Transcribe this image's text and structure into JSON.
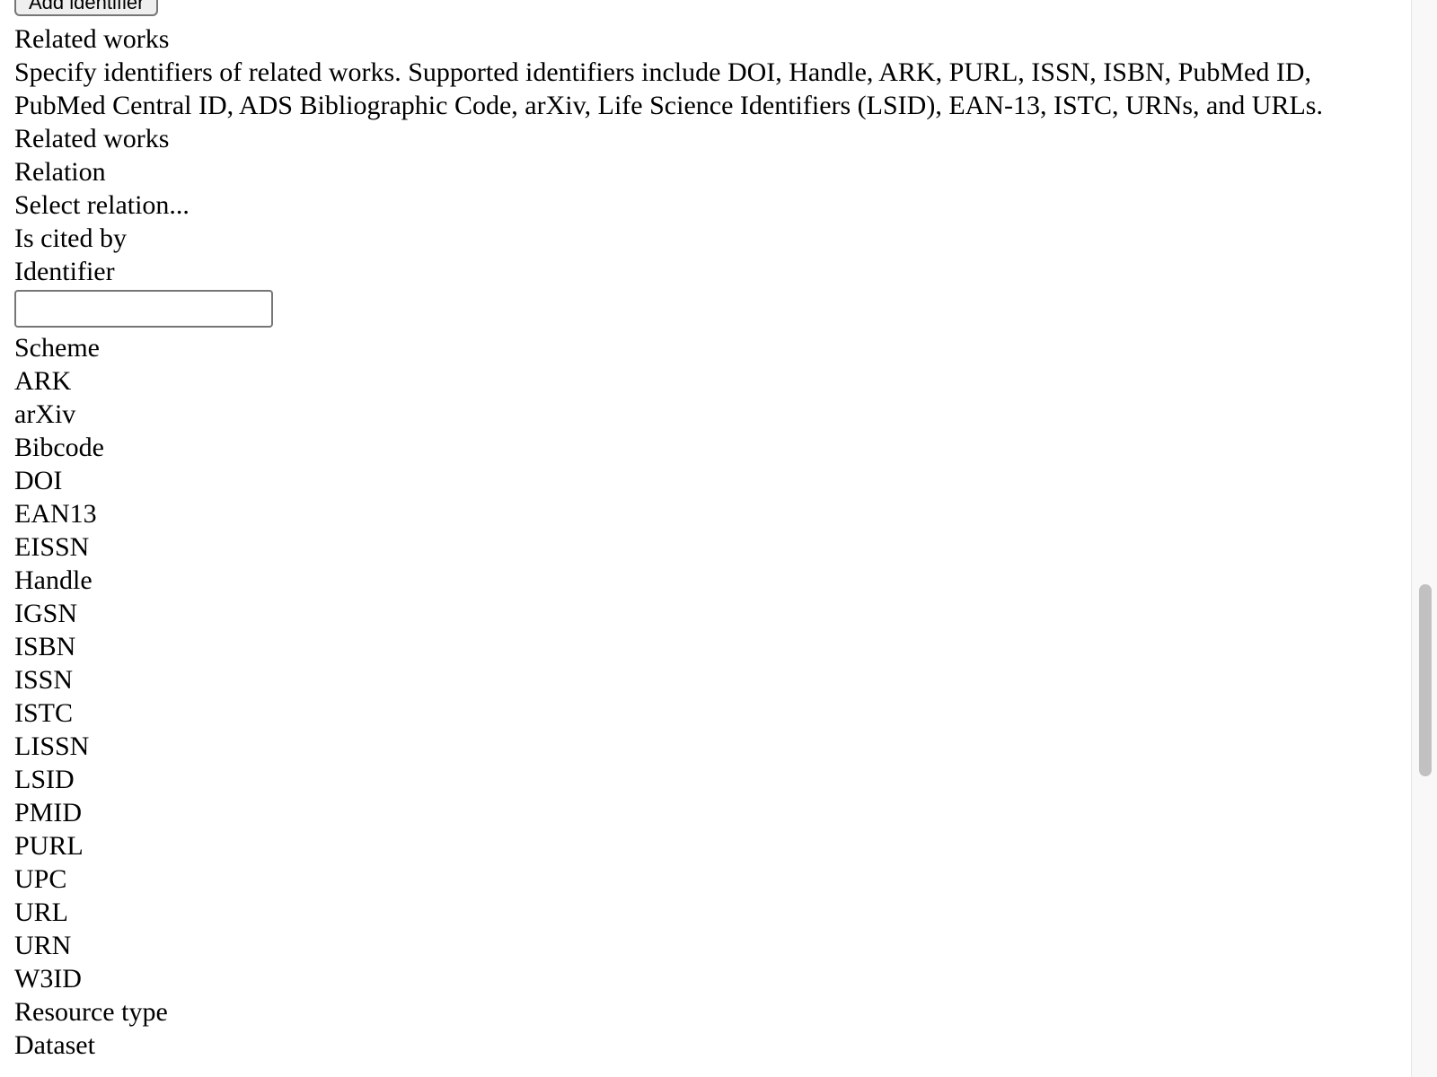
{
  "form": {
    "add_identifier_label": "Add identifier",
    "related_works_heading": "Related works",
    "related_works_description": "Specify identifiers of related works. Supported identifiers include DOI, Handle, ARK, PURL, ISSN, ISBN, PubMed ID, PubMed Central ID, ADS Bibliographic Code, arXiv, Life Science Identifiers (LSID), EAN-13, ISTC, URNs, and URLs.",
    "related_works_label": "Related works",
    "relation_label": "Relation",
    "relation_options": [
      "Select relation...",
      "Is cited by"
    ],
    "identifier_label": "Identifier",
    "identifier_value": "",
    "scheme_label": "Scheme",
    "scheme_options": [
      "ARK",
      "arXiv",
      "Bibcode",
      "DOI",
      "EAN13",
      "EISSN",
      "Handle",
      "IGSN",
      "ISBN",
      "ISSN",
      "ISTC",
      "LISSN",
      "LSID",
      "PMID",
      "PURL",
      "UPC",
      "URL",
      "URN",
      "W3ID"
    ],
    "resource_type_label": "Resource type",
    "resource_type_options": [
      "Dataset"
    ]
  },
  "scrollbar": {
    "position_fraction": 0.66
  }
}
